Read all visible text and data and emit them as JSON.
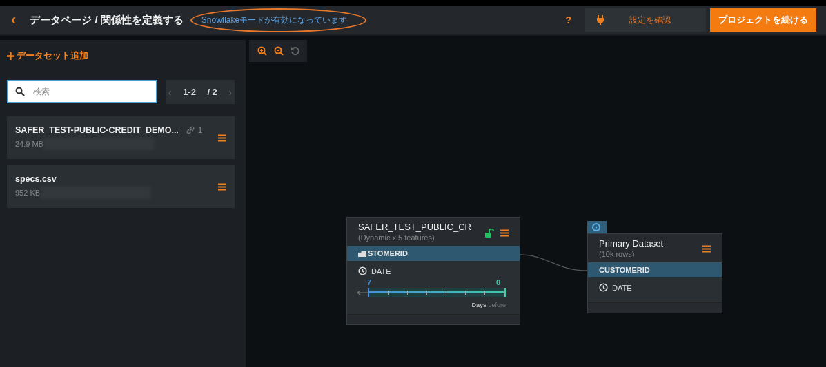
{
  "header": {
    "back": "‹",
    "title": "データページ / 関係性を定義する",
    "notice": "Snowflakeモードが有効になっています",
    "help": "?",
    "settings_button": "設定を確認",
    "continue_button": "プロジェクトを続ける"
  },
  "sidebar": {
    "add_button": "データセット追加",
    "search": {
      "placeholder": "検索"
    },
    "pager": {
      "previous": "‹",
      "range": "1-2",
      "total": "/ 2",
      "next": "›"
    },
    "datasets": [
      {
        "name": "SAFER_TEST-PUBLIC-CREDIT_DEMO...",
        "size": "24.9 MB",
        "links": "1"
      },
      {
        "name": "specs.csv",
        "size": "952 KB"
      }
    ]
  },
  "nodes": [
    {
      "kind": "secondary",
      "title": "SAFER_TEST_PUBLIC_CR",
      "subtitle": "(Dynamic x 5 features)",
      "key": "STOMERID",
      "date": "DATE",
      "window_start": "7",
      "window_end": "0",
      "unit": "Days",
      "unit_suffix": "before"
    },
    {
      "kind": "primary",
      "title": "Primary Dataset",
      "subtitle": "(10k rows)",
      "key": "CUSTOMERID",
      "date": "DATE"
    }
  ]
}
